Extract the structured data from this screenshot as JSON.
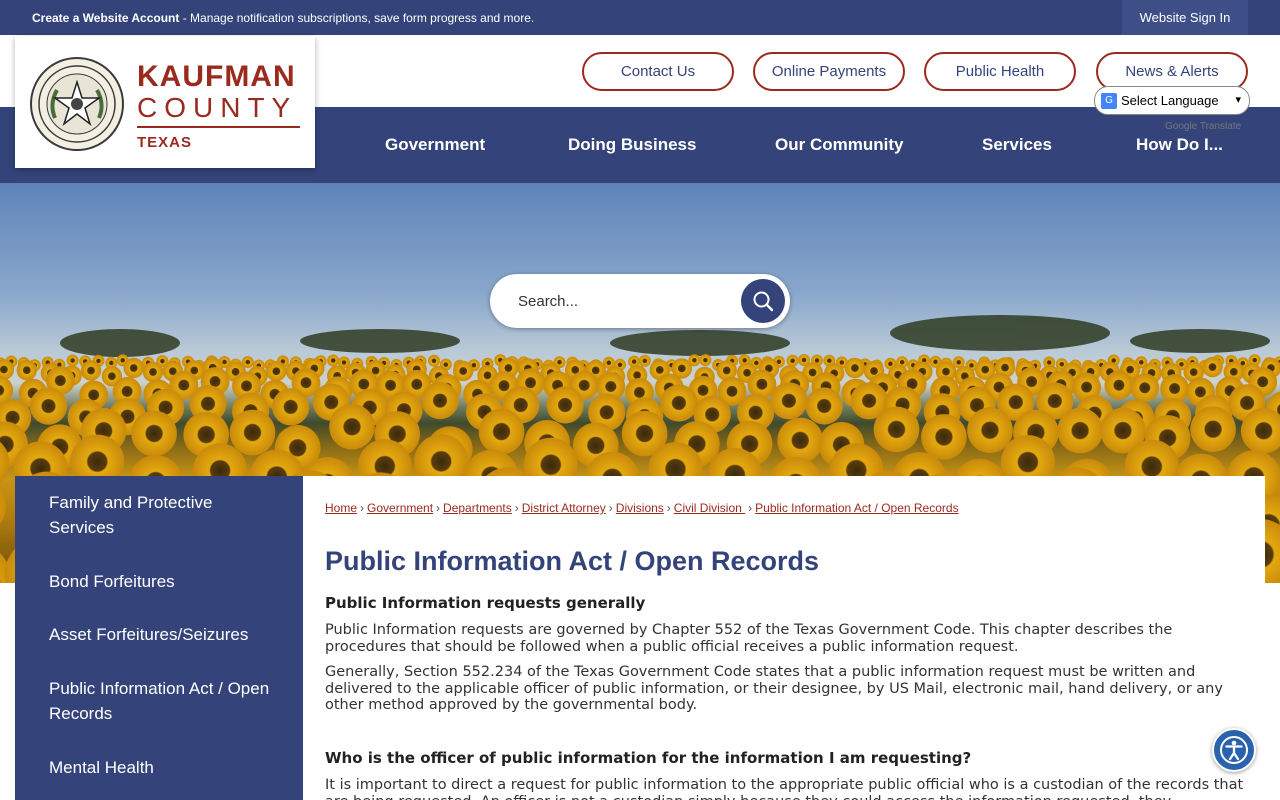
{
  "topbar": {
    "create_bold": "Create a Website Account",
    "create_rest": " - Manage notification subscriptions, save form progress and more.",
    "signin": "Website Sign In"
  },
  "logo": {
    "name": "KAUFMAN",
    "county": "COUNTY",
    "state": "TEXAS"
  },
  "header_links": [
    "Contact Us",
    "Online Payments",
    "Public Health",
    "News & Alerts"
  ],
  "translate": {
    "select_label": "Select Language",
    "powered_by": "Google Translate"
  },
  "nav": [
    "Government",
    "Doing Business",
    "Our Community",
    "Services",
    "How Do I..."
  ],
  "search": {
    "placeholder": "Search..."
  },
  "sidebar": {
    "items": [
      "Family and Protective Services",
      "Bond Forfeitures",
      "Asset Forfeitures/Seizures",
      "Public Information Act / Open Records",
      "Mental Health"
    ]
  },
  "breadcrumb": [
    "Home",
    "Government",
    "Departments",
    "District Attorney",
    "Divisions",
    "Civil Division ",
    "Public Information Act / Open Records"
  ],
  "page": {
    "title": "Public Information Act / Open Records",
    "h1": "Public Information requests generally",
    "p1": "Public Information requests are governed by Chapter 552 of the Texas Government Code.  This chapter describes the procedures that should be followed when a public official receives a public information request.",
    "p2": "Generally, Section 552.234 of the Texas Government Code states that a public information request must be written and delivered to the applicable officer of public information, or their designee, by US Mail, electronic mail, hand delivery, or any other method approved by the governmental body.",
    "h2": "Who is the officer of public information for the information I am requesting?",
    "p3": "It is important to direct a request for public information to the appropriate public official who is a custodian of the records that are being requested.  An officer is not a custodian simply because they could access the information requested, they"
  },
  "colors": {
    "navy": "#34447a",
    "brand_red": "#9b2a1e",
    "a11y_blue": "#2b62ad"
  }
}
